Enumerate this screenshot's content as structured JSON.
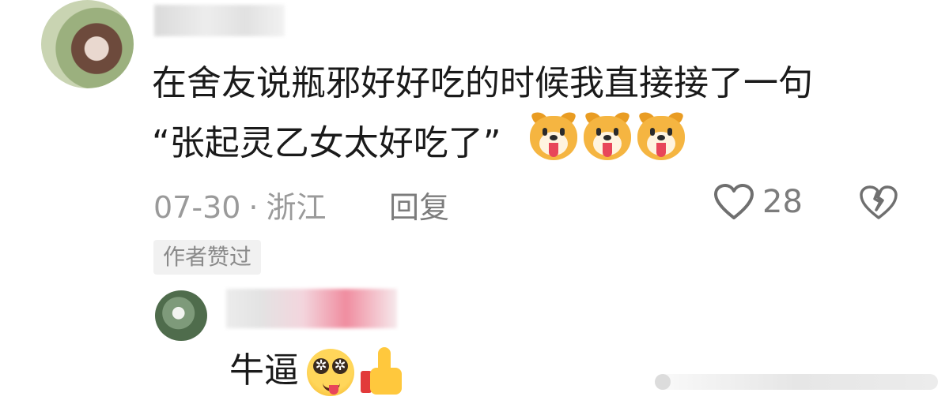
{
  "comment": {
    "text_line1": "在舍友说瓶邪好好吃的时候我直接接了一句",
    "text_line2": "“张起灵乙女太好吃了”",
    "emojis": [
      "dog-tongue-icon",
      "dog-tongue-icon",
      "dog-tongue-icon"
    ],
    "date": "07-30",
    "separator": "·",
    "location": "浙江",
    "reply_label": "回复",
    "like_count": "28",
    "author_liked_badge": "作者赞过"
  },
  "reply": {
    "text": "牛逼",
    "emojis": [
      "star-eyes-face-icon",
      "thumbs-up-icon"
    ]
  },
  "colors": {
    "text": "#1a1a1a",
    "meta": "#9a9a9a",
    "badge_bg": "#f1f1f1",
    "accent_pink": "#f08da0"
  }
}
